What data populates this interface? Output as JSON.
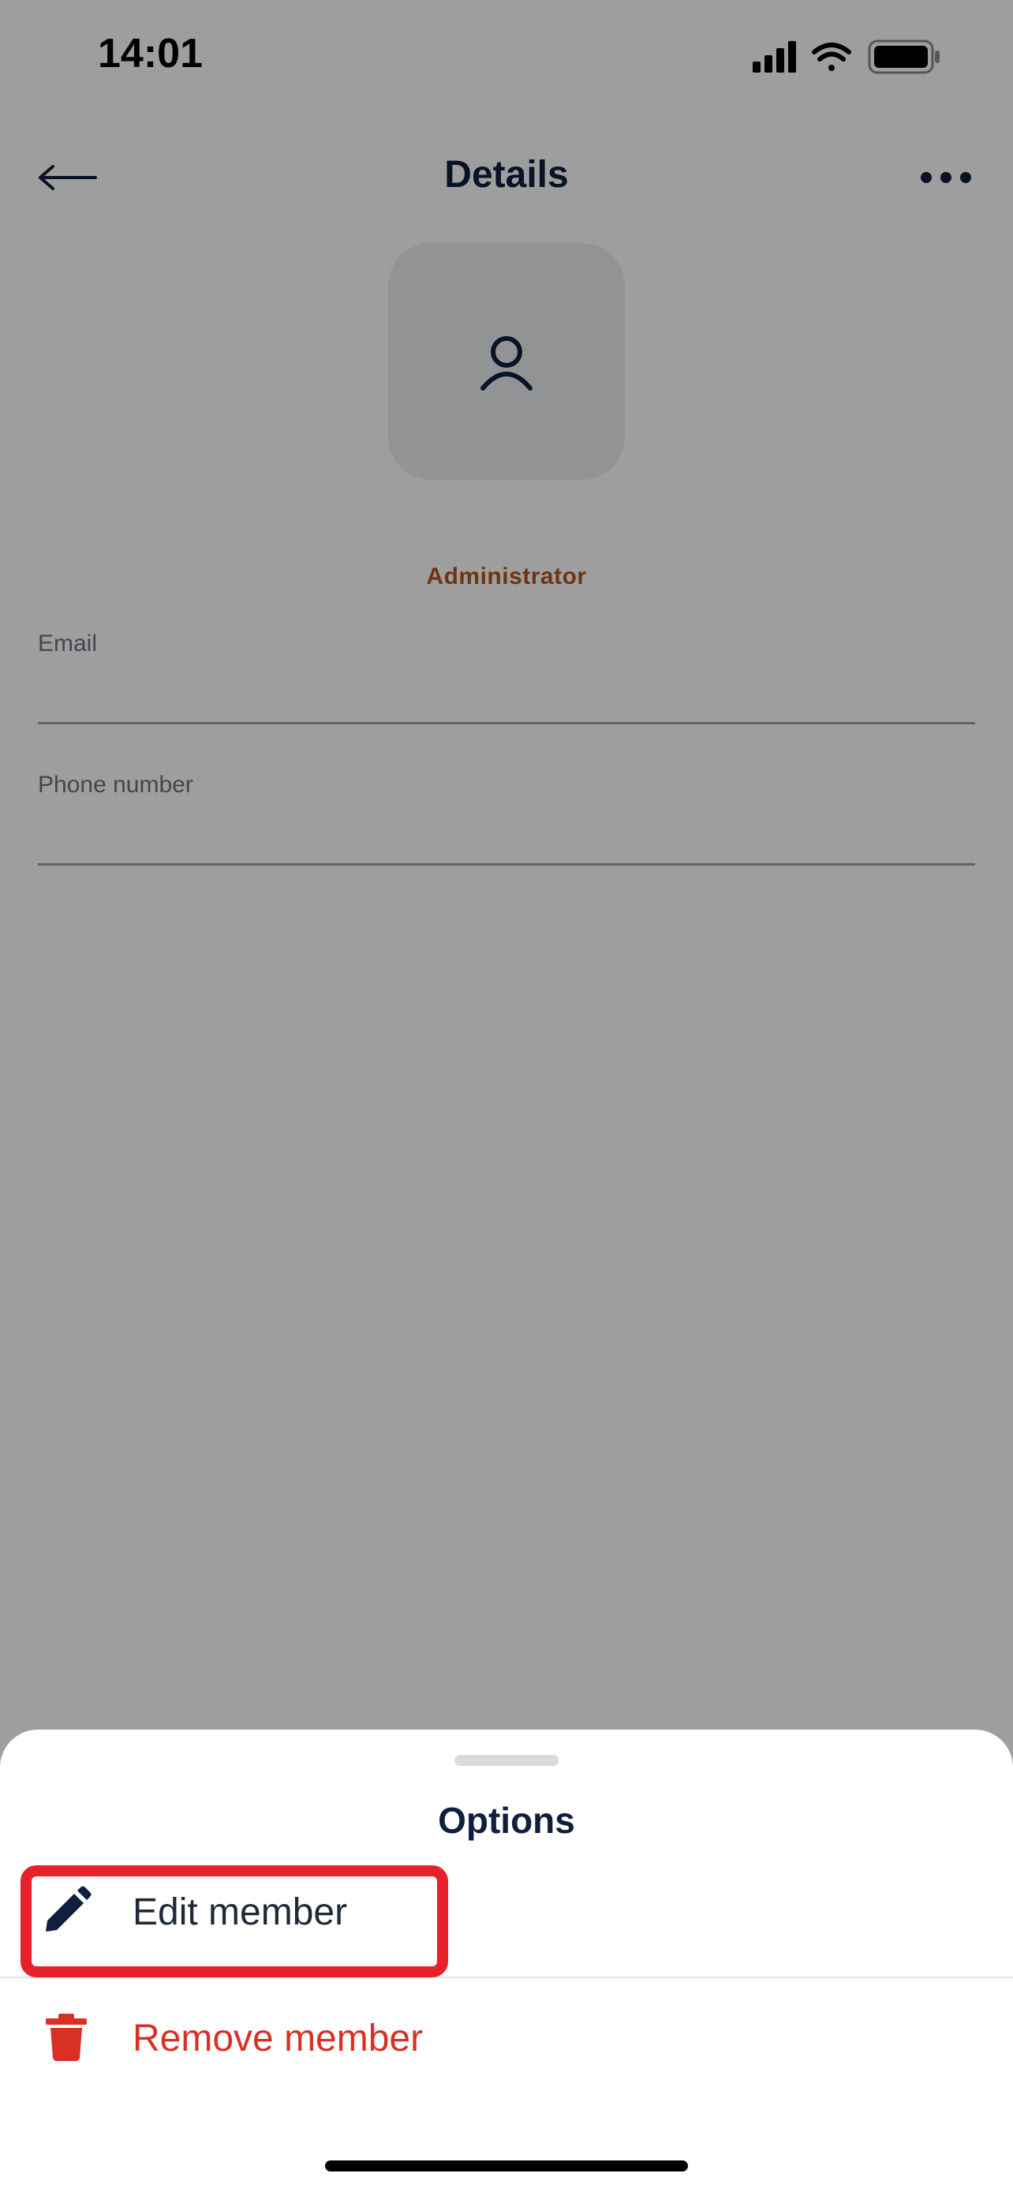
{
  "status_bar": {
    "time": "14:01"
  },
  "header": {
    "title": "Details",
    "back_icon": "arrow-left-icon",
    "more_icon": "more-horizontal-icon"
  },
  "profile": {
    "avatar_icon": "user-icon",
    "role": "Administrator"
  },
  "fields": {
    "email_label": "Email",
    "email_value": "",
    "phone_label": "Phone number",
    "phone_value": ""
  },
  "sheet": {
    "title": "Options",
    "options": [
      {
        "label": "Edit member",
        "icon": "pencil-icon",
        "highlighted": true
      },
      {
        "label": "Remove member",
        "icon": "trash-icon",
        "color": "#d93025"
      }
    ]
  },
  "colors": {
    "primary_text": "#0f1f3d",
    "role_accent": "#b4541a",
    "danger": "#d93025",
    "highlight": "#e8202a"
  }
}
